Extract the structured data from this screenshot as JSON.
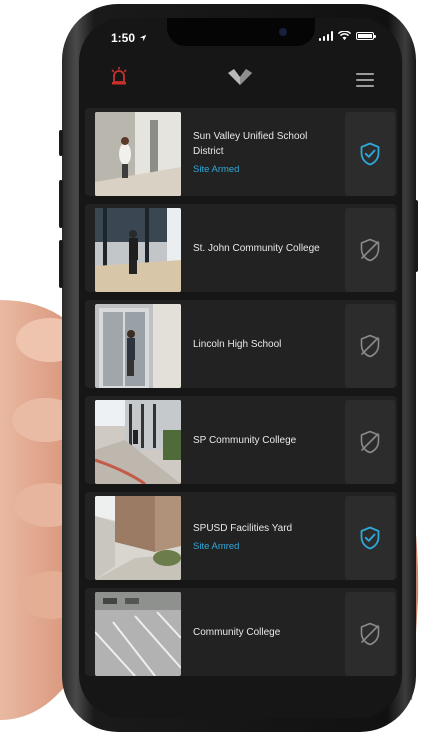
{
  "status_bar": {
    "time": "1:50"
  },
  "app_bar": {
    "alarm_icon": "siren-icon",
    "logo_icon": "v-logo-icon",
    "menu_icon": "hamburger-icon"
  },
  "colors": {
    "accent": "#2fa8d8",
    "alarm": "#c9302c",
    "background": "#161616",
    "card": "#222222"
  },
  "sites": [
    {
      "name": "Sun Valley Unified School District",
      "status": "Site Armed",
      "armed": true,
      "thumb": "hallway-person"
    },
    {
      "name": "St. John Community College",
      "status": "",
      "armed": false,
      "thumb": "glass-doors-person"
    },
    {
      "name": "Lincoln High School",
      "status": "",
      "armed": false,
      "thumb": "door-person"
    },
    {
      "name": "SP Community College",
      "status": "",
      "armed": false,
      "thumb": "sidewalk"
    },
    {
      "name": "SPUSD Facilities Yard",
      "status": "Site Amred",
      "armed": true,
      "thumb": "building-corner"
    },
    {
      "name": "Community College",
      "status": "",
      "armed": false,
      "thumb": "parking-lot"
    }
  ]
}
